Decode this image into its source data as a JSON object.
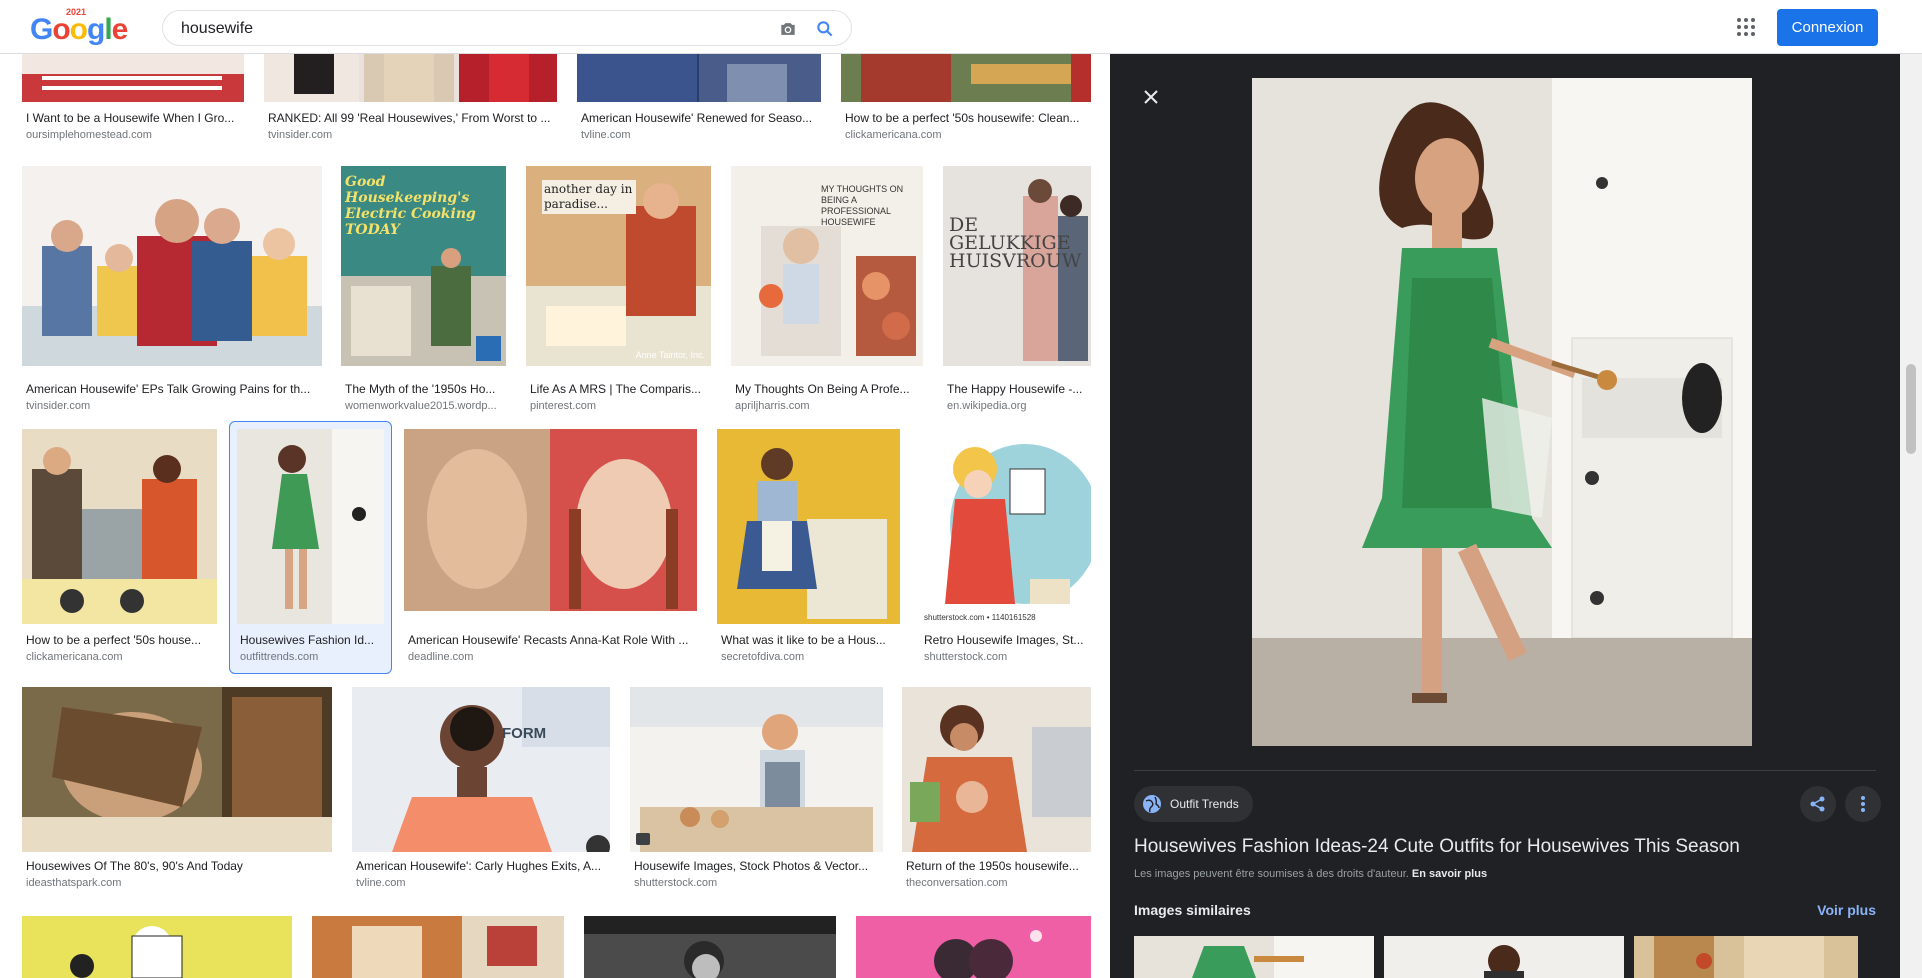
{
  "header": {
    "logo_letters": [
      "G",
      "o",
      "o",
      "g",
      "l",
      "e"
    ],
    "logo_year": "2021",
    "search_value": "housewife",
    "signin_label": "Connexion",
    "icons": [
      "camera-icon",
      "search-icon",
      "apps-grid-icon"
    ]
  },
  "results": [
    {
      "title": "I Want to be a Housewife When I Gro...",
      "source": "oursimplehomestead.com"
    },
    {
      "title": "RANKED: All 99 'Real Housewives,' From Worst to ...",
      "source": "tvinsider.com"
    },
    {
      "title": "American Housewife' Renewed for Seaso...",
      "source": "tvline.com"
    },
    {
      "title": "How to be a perfect '50s housewife: Clean...",
      "source": "clickamericana.com"
    },
    {
      "title": "American Housewife' EPs Talk Growing Pains for th...",
      "source": "tvinsider.com"
    },
    {
      "title": "The Myth of the '1950s Ho...",
      "source": "womenworkvalue2015.wordp..."
    },
    {
      "title": "Life As A MRS | The Comparis...",
      "source": "pinterest.com"
    },
    {
      "title": "My Thoughts On Being A Profe...",
      "source": "apriljharris.com"
    },
    {
      "title": "The Happy Housewife -...",
      "source": "en.wikipedia.org"
    },
    {
      "title": "How to be a perfect '50s house...",
      "source": "clickamericana.com"
    },
    {
      "title": "Housewives Fashion Id...",
      "source": "outfittrends.com"
    },
    {
      "title": "American Housewife' Recasts Anna-Kat Role With ...",
      "source": "deadline.com"
    },
    {
      "title": "What was it like to be a Hous...",
      "source": "secretofdiva.com"
    },
    {
      "title": "Retro Housewife Images, St...",
      "source": "shutterstock.com"
    },
    {
      "title": "Housewives Of The 80's, 90's And Today",
      "source": "ideasthatspark.com"
    },
    {
      "title": "American Housewife': Carly Hughes Exits, A...",
      "source": "tvline.com"
    },
    {
      "title": "Housewife Images, Stock Photos & Vector...",
      "source": "shutterstock.com"
    },
    {
      "title": "Return of the 1950s housewife...",
      "source": "theconversation.com"
    }
  ],
  "image_text": {
    "electric_cooking": "Good Housekeeping's Electric Cooking TODAY",
    "paradise": "another day in paradise...",
    "anne": "Anne Taintor, Inc.",
    "thoughts": "MY THOUGHTS ON BEING A PROFESSIONAL HOUSEWIFE",
    "dutch": "DE GELUKKIGE HUISVROUW",
    "shutter_id": "shutterstock.com • 1140161528",
    "form": "FORM"
  },
  "panel": {
    "source_chip": "Outfit Trends",
    "title": "Housewives Fashion Ideas-24 Cute Outfits for Housewives This Season",
    "rights_text": "Les images peuvent être soumises à des droits d'auteur.",
    "rights_link": "En savoir plus",
    "similar_label": "Images similaires",
    "see_more": "Voir plus"
  },
  "colors": {
    "brand_blue": "#1a73e8",
    "panel_bg": "#202124",
    "link_blue": "#8ab4f8",
    "selected_border": "#4285f4"
  }
}
